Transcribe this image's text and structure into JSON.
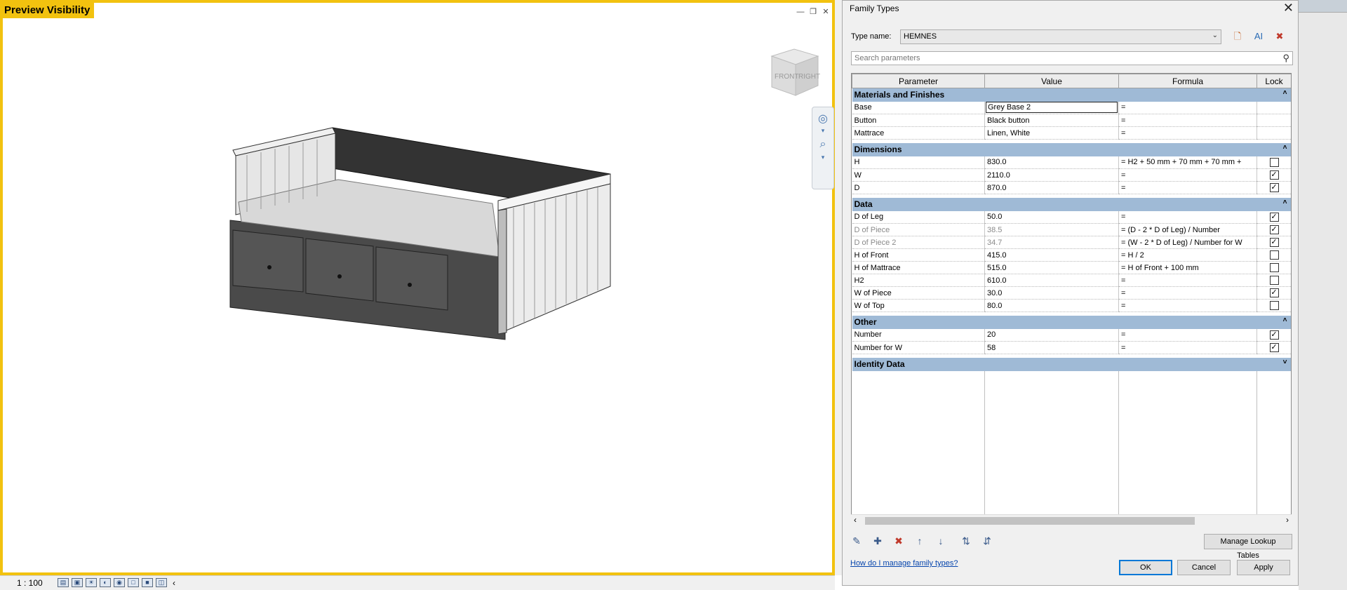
{
  "viewport": {
    "label": "Preview Visibility",
    "viewcube_front": "FRONT",
    "viewcube_right": "RIGHT",
    "scale": "1 : 100"
  },
  "dialog": {
    "title": "Family Types",
    "type_name_label": "Type name:",
    "type_name_value": "HEMNES",
    "search_placeholder": "Search parameters",
    "columns": [
      "Parameter",
      "Value",
      "Formula",
      "Lock"
    ],
    "groups": [
      {
        "name": "Materials and Finishes",
        "rows": [
          {
            "parameter": "Base",
            "value": "Grey Base 2",
            "formula": "=",
            "lock": null
          },
          {
            "parameter": "Button",
            "value": "Black button",
            "formula": "=",
            "lock": null
          },
          {
            "parameter": "Mattrace",
            "value": "Linen, White",
            "formula": "=",
            "lock": null
          }
        ]
      },
      {
        "name": "Dimensions",
        "rows": [
          {
            "parameter": "H",
            "value": "830.0",
            "formula": "= H2 + 50 mm + 70 mm + 70 mm +",
            "lock": false
          },
          {
            "parameter": "W",
            "value": "2110.0",
            "formula": "=",
            "lock": true
          },
          {
            "parameter": "D",
            "value": "870.0",
            "formula": "=",
            "lock": true
          }
        ]
      },
      {
        "name": "Data",
        "rows": [
          {
            "parameter": "D of Leg",
            "value": "50.0",
            "formula": "=",
            "lock": true
          },
          {
            "parameter": "D of Piece",
            "value": "38.5",
            "formula": "= (D - 2 * D of Leg) / Number",
            "lock": true,
            "dimmed": true
          },
          {
            "parameter": "D of Piece 2",
            "value": "34.7",
            "formula": "= (W - 2 * D of Leg) / Number for W",
            "lock": true,
            "dimmed": true
          },
          {
            "parameter": "H of Front",
            "value": "415.0",
            "formula": "= H / 2",
            "lock": false
          },
          {
            "parameter": "H of Mattrace",
            "value": "515.0",
            "formula": "= H of Front + 100 mm",
            "lock": false
          },
          {
            "parameter": "H2",
            "value": "610.0",
            "formula": "=",
            "lock": false
          },
          {
            "parameter": "W of Piece",
            "value": "30.0",
            "formula": "=",
            "lock": true
          },
          {
            "parameter": "W of Top",
            "value": "80.0",
            "formula": "=",
            "lock": false
          }
        ]
      },
      {
        "name": "Other",
        "rows": [
          {
            "parameter": "Number",
            "value": "20",
            "formula": "=",
            "lock": true
          },
          {
            "parameter": "Number for W",
            "value": "58",
            "formula": "=",
            "lock": true
          }
        ]
      },
      {
        "name": "Identity Data",
        "rows": []
      }
    ],
    "manage_lookup_label": "Manage Lookup Tables",
    "help_link": "How do I manage family types?",
    "ok_label": "OK",
    "cancel_label": "Cancel",
    "apply_label": "Apply"
  }
}
